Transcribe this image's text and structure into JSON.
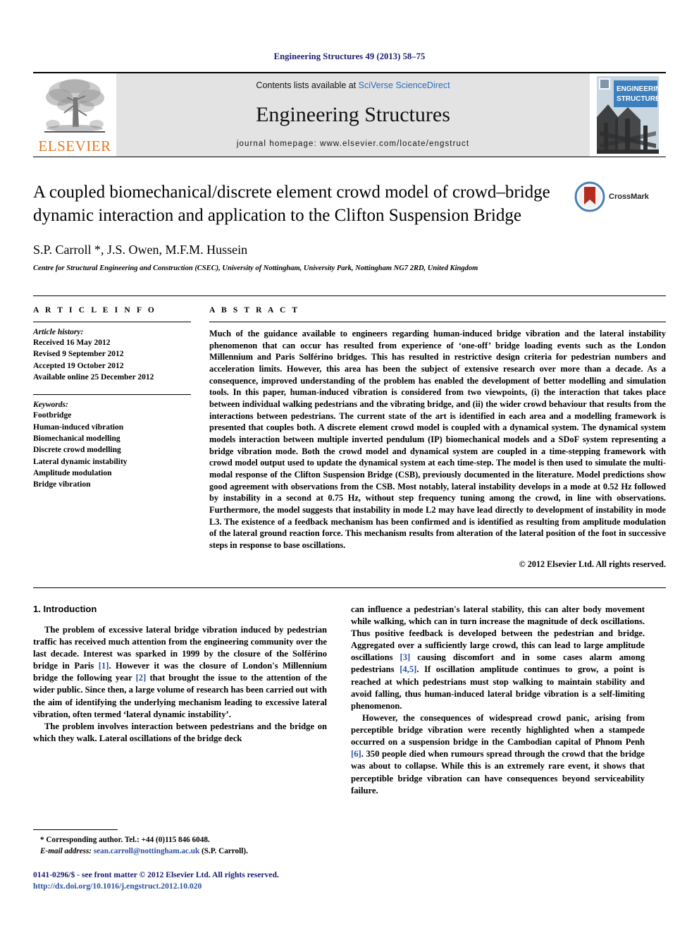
{
  "running_head": "Engineering Structures 49 (2013) 58–75",
  "masthead": {
    "publisher_name": "ELSEVIER",
    "contents_prefix": "Contents lists available at ",
    "contents_link": "SciVerse ScienceDirect",
    "journal_name": "Engineering Structures",
    "homepage": "journal homepage: www.elsevier.com/locate/engstruct",
    "cover_title_line1": "ENGINEERING",
    "cover_title_line2": "STRUCTURES"
  },
  "article": {
    "title": "A coupled biomechanical/discrete element crowd model of crowd–bridge dynamic interaction and application to the Clifton Suspension Bridge",
    "authors": "S.P. Carroll *, J.S. Owen, M.F.M. Hussein",
    "affiliation": "Centre for Structural Engineering and Construction (CSEC), University of Nottingham, University Park, Nottingham NG7 2RD, United Kingdom",
    "crossmark_label": "CrossMark"
  },
  "article_info": {
    "heading": "A R T I C L E   I N F O",
    "history_label": "Article history:",
    "history": [
      "Received 16 May 2012",
      "Revised 9 September 2012",
      "Accepted 19 October 2012",
      "Available online 25 December 2012"
    ],
    "keywords_label": "Keywords:",
    "keywords": [
      "Footbridge",
      "Human-induced vibration",
      "Biomechanical modelling",
      "Discrete crowd modelling",
      "Lateral dynamic instability",
      "Amplitude modulation",
      "Bridge vibration"
    ]
  },
  "abstract": {
    "heading": "A B S T R A C T",
    "text": "Much of the guidance available to engineers regarding human-induced bridge vibration and the lateral instability phenomenon that can occur has resulted from experience of ‘one-off’ bridge loading events such as the London Millennium and Paris Solférino bridges. This has resulted in restrictive design criteria for pedestrian numbers and acceleration limits. However, this area has been the subject of extensive research over more than a decade. As a consequence, improved understanding of the problem has enabled the development of better modelling and simulation tools. In this paper, human-induced vibration is considered from two viewpoints, (i) the interaction that takes place between individual walking pedestrians and the vibrating bridge, and (ii) the wider crowd behaviour that results from the interactions between pedestrians. The current state of the art is identified in each area and a modelling framework is presented that couples both. A discrete element crowd model is coupled with a dynamical system. The dynamical system models interaction between multiple inverted pendulum (IP) biomechanical models and a SDoF system representing a bridge vibration mode. Both the crowd model and dynamical system are coupled in a time-stepping framework with crowd model output used to update the dynamical system at each time-step. The model is then used to simulate the multi-modal response of the Clifton Suspension Bridge (CSB), previously documented in the literature. Model predictions show good agreement with observations from the CSB. Most notably, lateral instability develops in a mode at 0.52 Hz followed by instability in a second at 0.75 Hz, without step frequency tuning among the crowd, in line with observations. Furthermore, the model suggests that instability in mode L2 may have lead directly to development of instability in mode L3. The existence of a feedback mechanism has been confirmed and is identified as resulting from amplitude modulation of the lateral ground reaction force. This mechanism results from alteration of the lateral position of the foot in successive steps in response to base oscillations.",
    "copyright": "© 2012 Elsevier Ltd. All rights reserved."
  },
  "introduction": {
    "section_title": "1. Introduction",
    "left_para_1_a": "The problem of excessive lateral bridge vibration induced by pedestrian traffic has received much attention from the engineering community over the last decade. Interest was sparked in 1999 by the closure of the Solférino bridge in Paris ",
    "left_cite_1": "[1]",
    "left_para_1_b": ". However it was the closure of London's Millennium bridge the following year ",
    "left_cite_2": "[2]",
    "left_para_1_c": " that brought the issue to the attention of the wider public. Since then, a large volume of research has been carried out with the aim of identifying the underlying mechanism leading to excessive lateral vibration, often termed ‘lateral dynamic instability’.",
    "left_para_2": "The problem involves interaction between pedestrians and the bridge on which they walk. Lateral oscillations of the bridge deck",
    "right_para_1_a": "can influence a pedestrian's lateral stability, this can alter body movement while walking, which can in turn increase the magnitude of deck oscillations. Thus positive feedback is developed between the pedestrian and bridge. Aggregated over a sufficiently large crowd, this can lead to large amplitude oscillations ",
    "right_cite_3": "[3]",
    "right_para_1_b": " causing discomfort and in some cases alarm among pedestrians ",
    "right_cite_45": "[4,5]",
    "right_para_1_c": ". If oscillation amplitude continues to grow, a point is reached at which pedestrians must stop walking to maintain stability and avoid falling, thus human-induced lateral bridge vibration is a self-limiting phenomenon.",
    "right_para_2_a": "However, the consequences of widespread crowd panic, arising from perceptible bridge vibration were recently highlighted when a stampede occurred on a suspension bridge in the Cambodian capital of Phnom Penh ",
    "right_cite_6": "[6]",
    "right_para_2_b": ". 350 people died when rumours spread through the crowd that the bridge was about to collapse. While this is an extremely rare event, it shows that perceptible bridge vibration can have consequences beyond serviceability failure."
  },
  "footnote": {
    "corresponding": "* Corresponding author. Tel.: +44 (0)115 846 6048.",
    "email_label": "E-mail address:",
    "email": "sean.carroll@nottingham.ac.uk",
    "email_suffix": "(S.P. Carroll)."
  },
  "footer": {
    "issn_line": "0141-0296/$ - see front matter © 2012 Elsevier Ltd. All rights reserved.",
    "doi": "http://dx.doi.org/10.1016/j.engstruct.2012.10.020"
  },
  "colors": {
    "header_blue": "#1a1a6e",
    "link_blue": "#2b6cb8",
    "cite_blue": "#2b4f9e",
    "elsevier_orange": "#E87722",
    "masthead_gray": "#e3e3e3",
    "cover_blue": "#3b7fbf",
    "crossmark_red": "#b5291f"
  }
}
